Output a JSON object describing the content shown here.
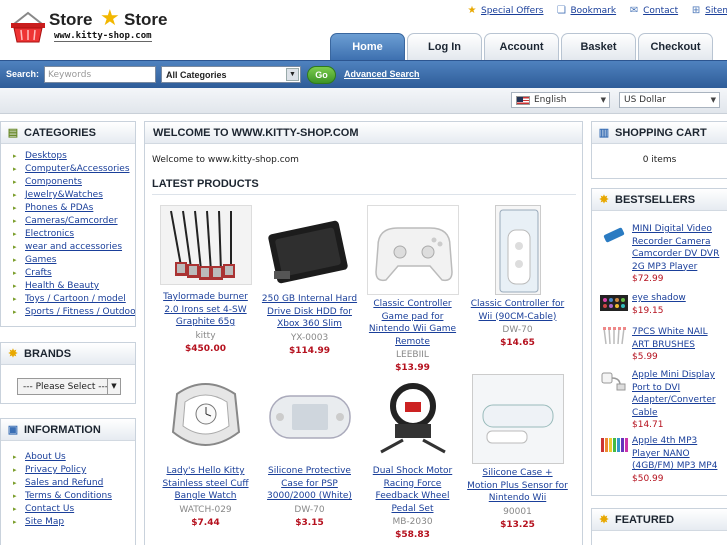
{
  "header": {
    "logo_word1": "Store",
    "logo_word2": "Store",
    "logo_url": "www.kitty-shop.com",
    "top_links": [
      {
        "label": "Special Offers",
        "icon": "star-icon"
      },
      {
        "label": "Bookmark",
        "icon": "bookmark-icon"
      },
      {
        "label": "Contact",
        "icon": "mail-icon"
      },
      {
        "label": "Sitemap",
        "icon": "sitemap-icon"
      }
    ]
  },
  "tabs": [
    {
      "label": "Home",
      "active": true
    },
    {
      "label": "Log In",
      "active": false
    },
    {
      "label": "Account",
      "active": false
    },
    {
      "label": "Basket",
      "active": false
    },
    {
      "label": "Checkout",
      "active": false
    }
  ],
  "search": {
    "label": "Search:",
    "placeholder": "Keywords",
    "category": "All Categories",
    "go": "Go",
    "advanced": "Advanced Search"
  },
  "locale": {
    "language": "English",
    "currency": "US Dollar"
  },
  "categories": {
    "title": "CATEGORIES",
    "items": [
      "Desktops",
      "Computer&Accessories",
      "Components",
      "Jewelry&Watches",
      "Phones & PDAs",
      "Cameras/Camcorder",
      "Electronics",
      "wear and accessories",
      "Games",
      "Crafts",
      "Health & Beauty",
      "Toys / Cartoon / model",
      "Sports / Fitness / Outdoor"
    ]
  },
  "brands": {
    "title": "BRANDS",
    "select": "--- Please Select ---"
  },
  "information": {
    "title": "INFORMATION",
    "items": [
      "About Us",
      "Privacy Policy",
      "Sales and Refund",
      "Terms & Conditions",
      "Contact Us",
      "Site Map"
    ]
  },
  "main": {
    "title": "WELCOME TO WWW.KITTY-SHOP.COM",
    "welcome": "Welcome to www.kitty-shop.com",
    "latest_title": "LATEST PRODUCTS",
    "products": [
      {
        "name": "Taylormade burner 2.0 Irons set 4-SW Graphite 65g",
        "model": "kitty",
        "price": "$450.00"
      },
      {
        "name": "250 GB Internal Hard Drive Disk HDD for Xbox 360 Slim",
        "model": "YX-0003",
        "price": "$114.99"
      },
      {
        "name": "Classic Controller Game pad for Nintendo Wii Game Remote",
        "model": "LEEBIIL",
        "price": "$13.99"
      },
      {
        "name": "Classic Controller for Wii (90CM-Cable)",
        "model": "DW-70",
        "price": "$14.65"
      },
      {
        "name": "Lady's Hello Kitty Stainless steel Cuff Bangle Watch",
        "model": "WATCH-029",
        "price": "$7.44"
      },
      {
        "name": "Silicone Protective Case for PSP 3000/2000 (White)",
        "model": "DW-70",
        "price": "$3.15"
      },
      {
        "name": "Dual Shock Motor Racing Force Feedback Wheel Pedal Set",
        "model": "MB-2030",
        "price": "$58.83"
      },
      {
        "name": "Silicone Case + Motion Plus Sensor for Nintendo Wii",
        "model": "90001",
        "price": "$13.25"
      }
    ]
  },
  "cart": {
    "title": "SHOPPING CART",
    "status": "0 items"
  },
  "bestsellers": {
    "title": "BESTSELLERS",
    "items": [
      {
        "name": "MINI Digital Video Recorder Camera Camcorder DV DVR 2G MP3 Player",
        "price": "$72.99"
      },
      {
        "name": "eye shadow",
        "price": "$19.15"
      },
      {
        "name": "7PCS White NAIL ART BRUSHES",
        "price": "$5.99"
      },
      {
        "name": "Apple Mini Display Port to DVI Adapter/Converter Cable",
        "price": "$14.71"
      },
      {
        "name": "Apple 4th MP3 Player NANO (4GB/FM) MP3 MP4",
        "price": "$50.99"
      }
    ]
  },
  "featured": {
    "title": "FEATURED"
  }
}
